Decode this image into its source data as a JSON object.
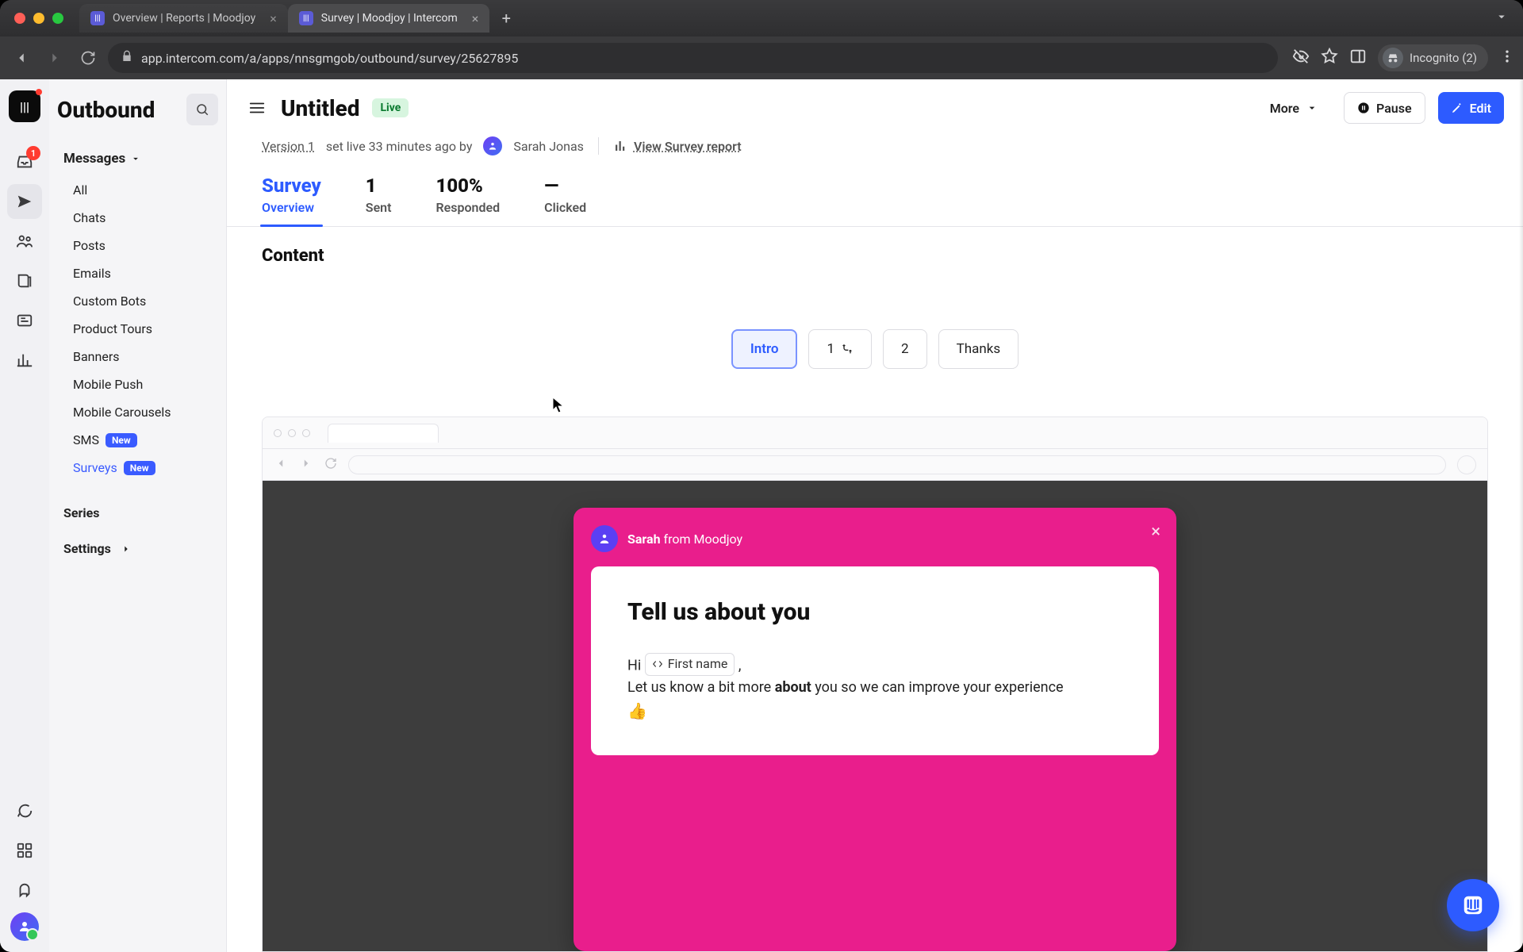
{
  "browser": {
    "tabs": [
      {
        "title": "Overview | Reports | Moodjoy",
        "active": false
      },
      {
        "title": "Survey | Moodjoy | Intercom",
        "active": true
      }
    ],
    "url": "app.intercom.com/a/apps/nnsgmgob/outbound/survey/25627895",
    "incognito_label": "Incognito (2)"
  },
  "rail": {
    "inbox_badge": "1"
  },
  "sidebar": {
    "title": "Outbound",
    "group_label": "Messages",
    "items": [
      {
        "label": "All"
      },
      {
        "label": "Chats"
      },
      {
        "label": "Posts"
      },
      {
        "label": "Emails"
      },
      {
        "label": "Custom Bots"
      },
      {
        "label": "Product Tours"
      },
      {
        "label": "Banners"
      },
      {
        "label": "Mobile Push"
      },
      {
        "label": "Mobile Carousels"
      },
      {
        "label": "SMS",
        "badge": "New"
      },
      {
        "label": "Surveys",
        "badge": "New",
        "active": true
      }
    ],
    "series_label": "Series",
    "settings_label": "Settings"
  },
  "topbar": {
    "title": "Untitled",
    "status": "Live",
    "more": "More",
    "pause": "Pause",
    "edit": "Edit"
  },
  "meta": {
    "version_link": "Version 1",
    "set_live_text": "set live 33 minutes ago by",
    "author": "Sarah Jonas",
    "report_link": "View Survey report"
  },
  "stats": [
    {
      "value": "Survey",
      "label": "Overview",
      "active": true
    },
    {
      "value": "1",
      "label": "Sent"
    },
    {
      "value": "100%",
      "label": "Responded"
    },
    {
      "value": "—",
      "label": "Clicked"
    }
  ],
  "content_heading": "Content",
  "steps": {
    "intro": "Intro",
    "one": "1",
    "two": "2",
    "thanks": "Thanks"
  },
  "survey": {
    "from_name": "Sarah",
    "from_suffix": "from Moodjoy",
    "title": "Tell us about you",
    "greeting": "Hi",
    "token": "First name",
    "comma": ",",
    "line2a": "Let us know a bit more ",
    "line2b": "about",
    "line2c": " you so we can improve your experience",
    "emoji": "👍"
  }
}
